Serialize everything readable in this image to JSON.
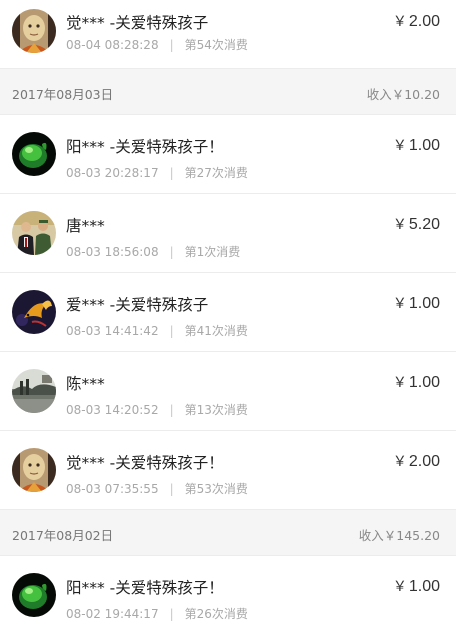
{
  "entries": [
    {
      "kind": "tx",
      "first": true,
      "avatar": "monk-avatar",
      "name": "觉*** -关爱特殊孩子",
      "time": "08-04 08:28:28",
      "count": "第54次消费",
      "amount": "2.00"
    },
    {
      "kind": "header",
      "date": "2017年08月03日",
      "income": "收入￥10.20"
    },
    {
      "kind": "tx",
      "avatar": "green-jade-avatar",
      "name": "阳*** -关爱特殊孩子！",
      "time": "08-03 20:28:17",
      "count": "第27次消费",
      "amount": "1.00"
    },
    {
      "kind": "tx",
      "avatar": "officials-photo-avatar",
      "name": "唐***",
      "time": "08-03 18:56:08",
      "count": "第1次消费",
      "amount": "5.20"
    },
    {
      "kind": "tx",
      "avatar": "goldfish-avatar",
      "name": "爱*** -关爱特殊孩子",
      "time": "08-03 14:41:42",
      "count": "第41次消费",
      "amount": "1.00"
    },
    {
      "kind": "tx",
      "avatar": "landscape-avatar",
      "name": "陈***",
      "time": "08-03 14:20:52",
      "count": "第13次消费",
      "amount": "1.00"
    },
    {
      "kind": "tx",
      "avatar": "monk-avatar",
      "name": "觉*** -关爱特殊孩子！",
      "time": "08-03 07:35:55",
      "count": "第53次消费",
      "amount": "2.00"
    },
    {
      "kind": "header",
      "date": "2017年08月02日",
      "income": "收入￥145.20"
    },
    {
      "kind": "tx",
      "avatar": "green-jade-avatar",
      "name": "阳*** -关爱特殊孩子！",
      "time": "08-02 19:44:17",
      "count": "第26次消费",
      "amount": "1.00"
    }
  ],
  "currency_symbol": "￥",
  "colors": {
    "header_bg": "#f5f5f5",
    "muted": "#a8a8a8",
    "divider": "#ececec"
  }
}
